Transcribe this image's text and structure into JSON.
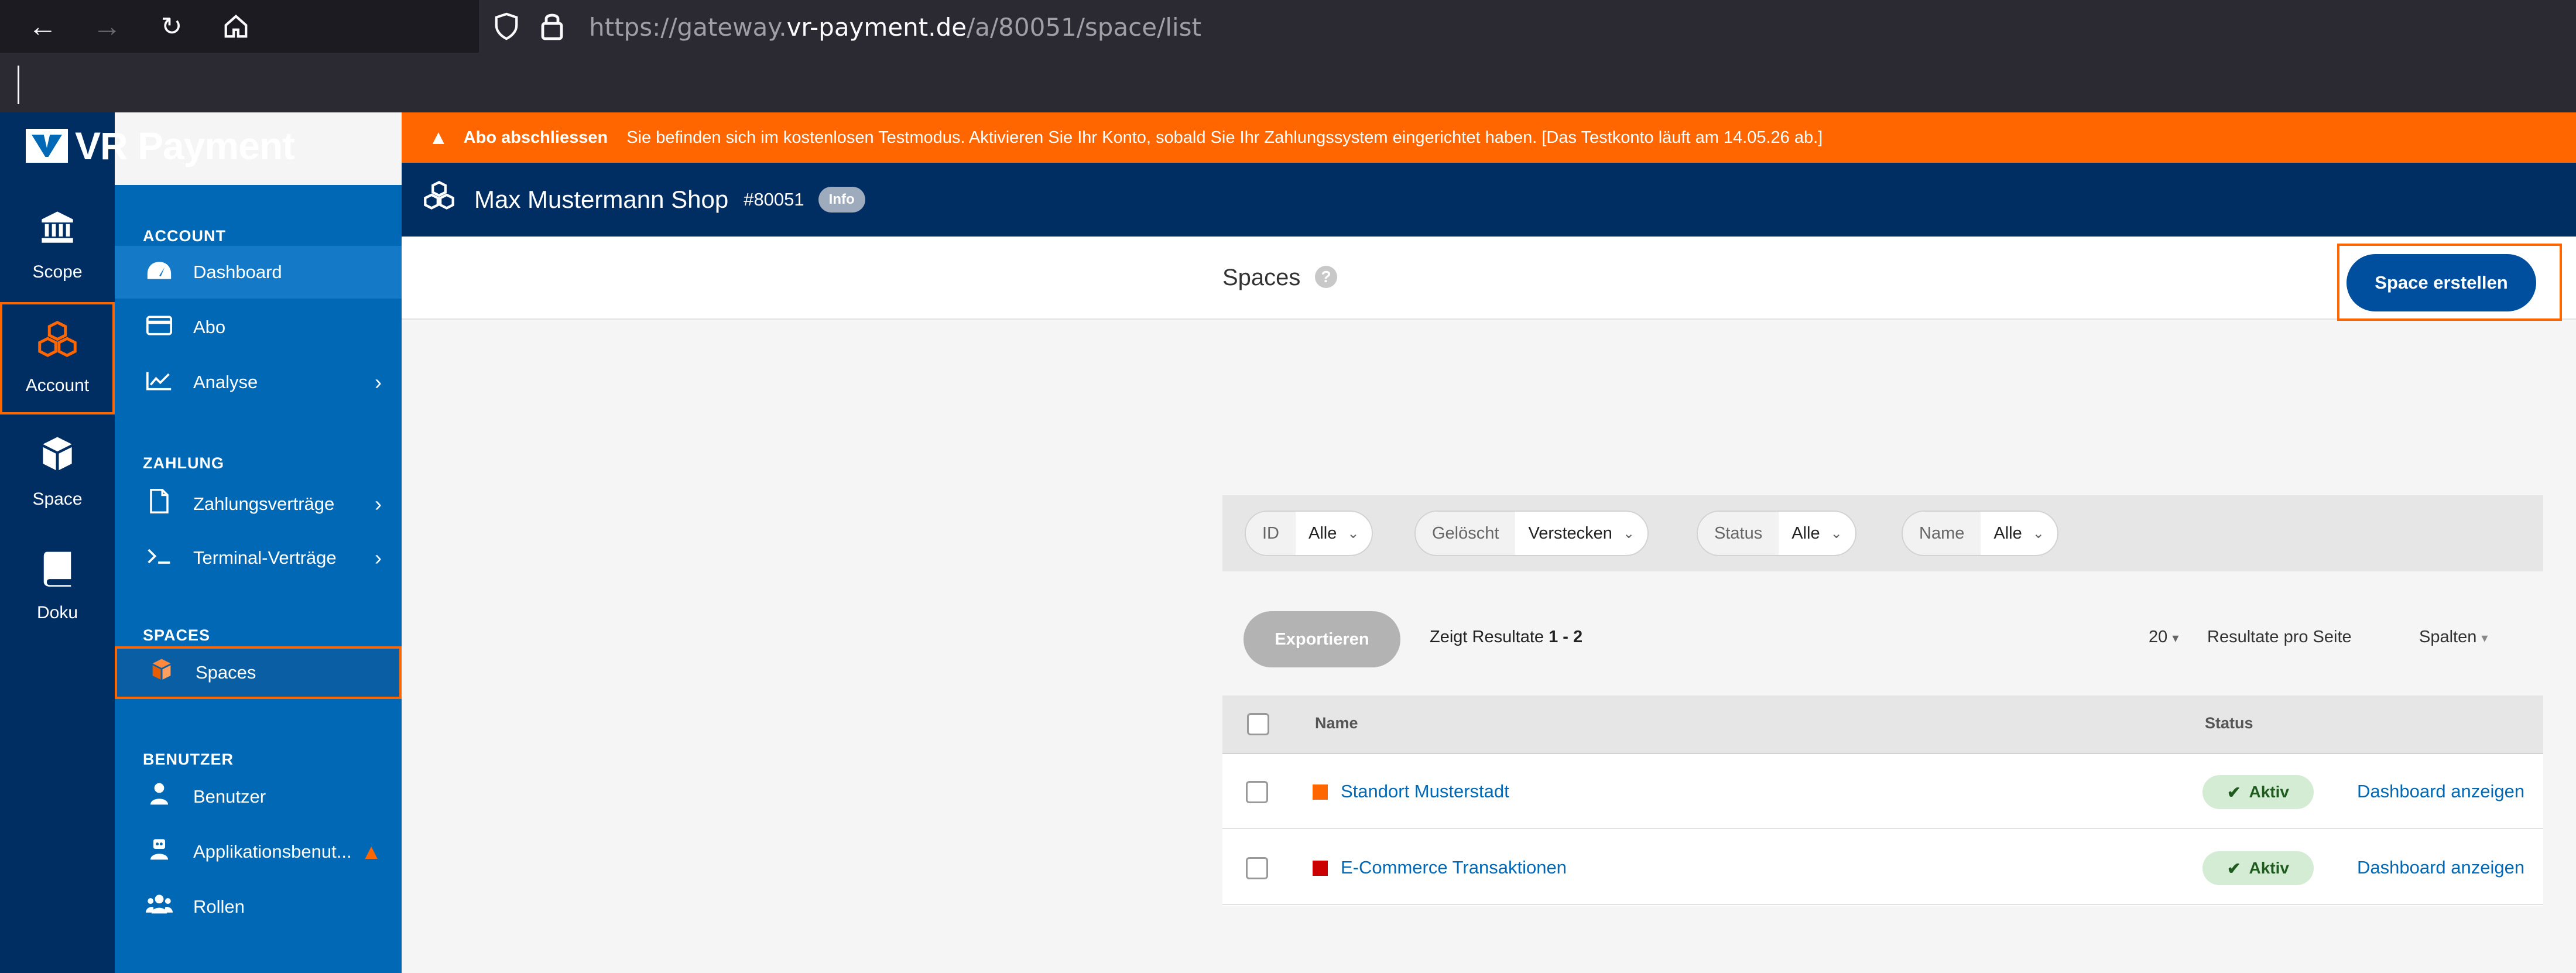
{
  "browser": {
    "url_prefix": "https://gateway.",
    "url_host": "vr-payment.de",
    "url_path": "/a/80051/space/list"
  },
  "brand": {
    "name": "VR Payment"
  },
  "rail": {
    "items": [
      {
        "label": "Scope",
        "icon": "bank-icon"
      },
      {
        "label": "Account",
        "icon": "boxes-icon"
      },
      {
        "label": "Space",
        "icon": "cube-icon"
      },
      {
        "label": "Doku",
        "icon": "book-icon"
      }
    ]
  },
  "sidebar": {
    "sections": {
      "account": "ACCOUNT",
      "zahlung": "ZAHLUNG",
      "spaces": "SPACES",
      "benutzer": "BENUTZER"
    },
    "items": {
      "dashboard": "Dashboard",
      "abo": "Abo",
      "analyse": "Analyse",
      "zahlungsvertraege": "Zahlungsverträge",
      "terminal": "Terminal-Verträge",
      "spaces": "Spaces",
      "benutzer": "Benutzer",
      "applikationsbenutzer": "Applikationsbenut...",
      "rollen": "Rollen"
    }
  },
  "banner": {
    "title": "Abo abschliessen",
    "text": "Sie befinden sich im kostenlosen Testmodus. Aktivieren Sie Ihr Konto, sobald Sie Ihr Zahlungssystem eingerichtet haben. [Das Testkonto läuft am 14.05.26 ab.]"
  },
  "header": {
    "title": "Max Mustermann Shop",
    "id": "#80051",
    "info": "Info"
  },
  "page": {
    "title": "Spaces",
    "create_button": "Space erstellen"
  },
  "filters": [
    {
      "label": "ID",
      "value": "Alle"
    },
    {
      "label": "Gelöscht",
      "value": "Verstecken"
    },
    {
      "label": "Status",
      "value": "Alle"
    },
    {
      "label": "Name",
      "value": "Alle"
    }
  ],
  "list_controls": {
    "export": "Exportieren",
    "results_prefix": "Zeigt Resultate ",
    "results_range": "1 - 2",
    "per_page": "20",
    "per_page_label": "Resultate pro Seite",
    "columns": "Spalten"
  },
  "table": {
    "columns": [
      "Name",
      "Status"
    ],
    "rows": [
      {
        "name": "Standort Musterstadt",
        "color": "#ff6600",
        "status": "Aktiv",
        "action": "Dashboard anzeigen"
      },
      {
        "name": "E-Commerce Transaktionen",
        "color": "#cc0000",
        "status": "Aktiv",
        "action": "Dashboard anzeigen"
      }
    ]
  },
  "colors": {
    "brand_dark": "#002d62",
    "brand_blue": "#0068b4",
    "accent_orange": "#ff6600",
    "status_green": "#d4ecd4"
  }
}
